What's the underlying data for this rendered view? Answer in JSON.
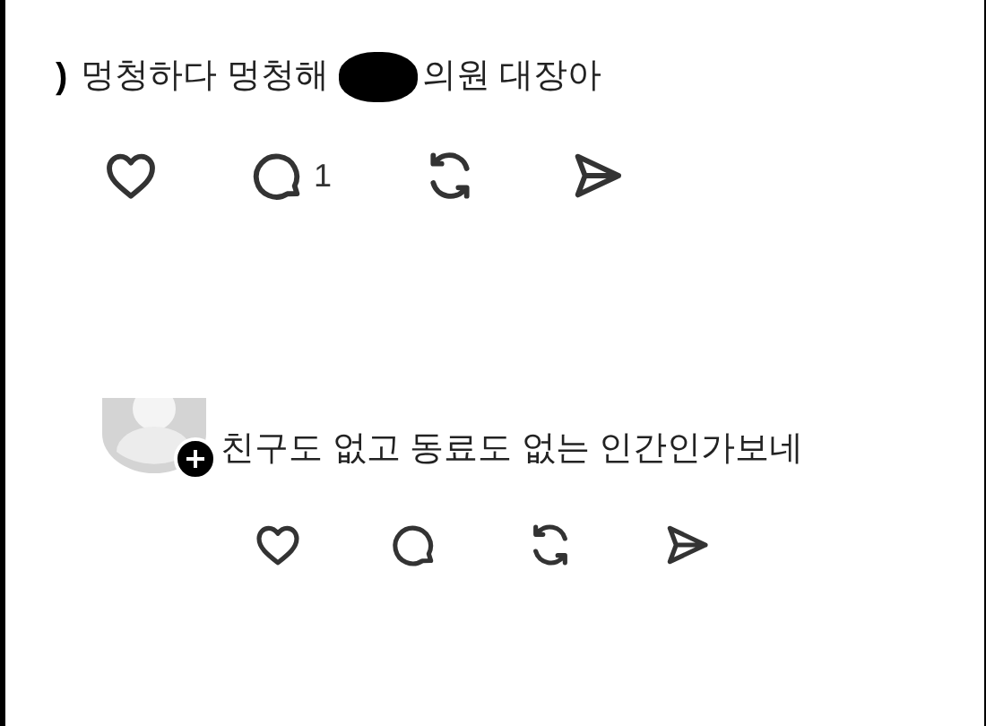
{
  "posts": [
    {
      "avatar": false,
      "edge_mark": ")",
      "segments": [
        {
          "kind": "text",
          "text": "멍청하다 멍청해"
        },
        {
          "kind": "redaction"
        },
        {
          "kind": "text",
          "text": "의원 대장아"
        }
      ],
      "comment_count": "1"
    },
    {
      "avatar": true,
      "segments": [
        {
          "kind": "text",
          "text": "친구도 없고 동료도 없는 인간인가보네"
        }
      ]
    }
  ]
}
